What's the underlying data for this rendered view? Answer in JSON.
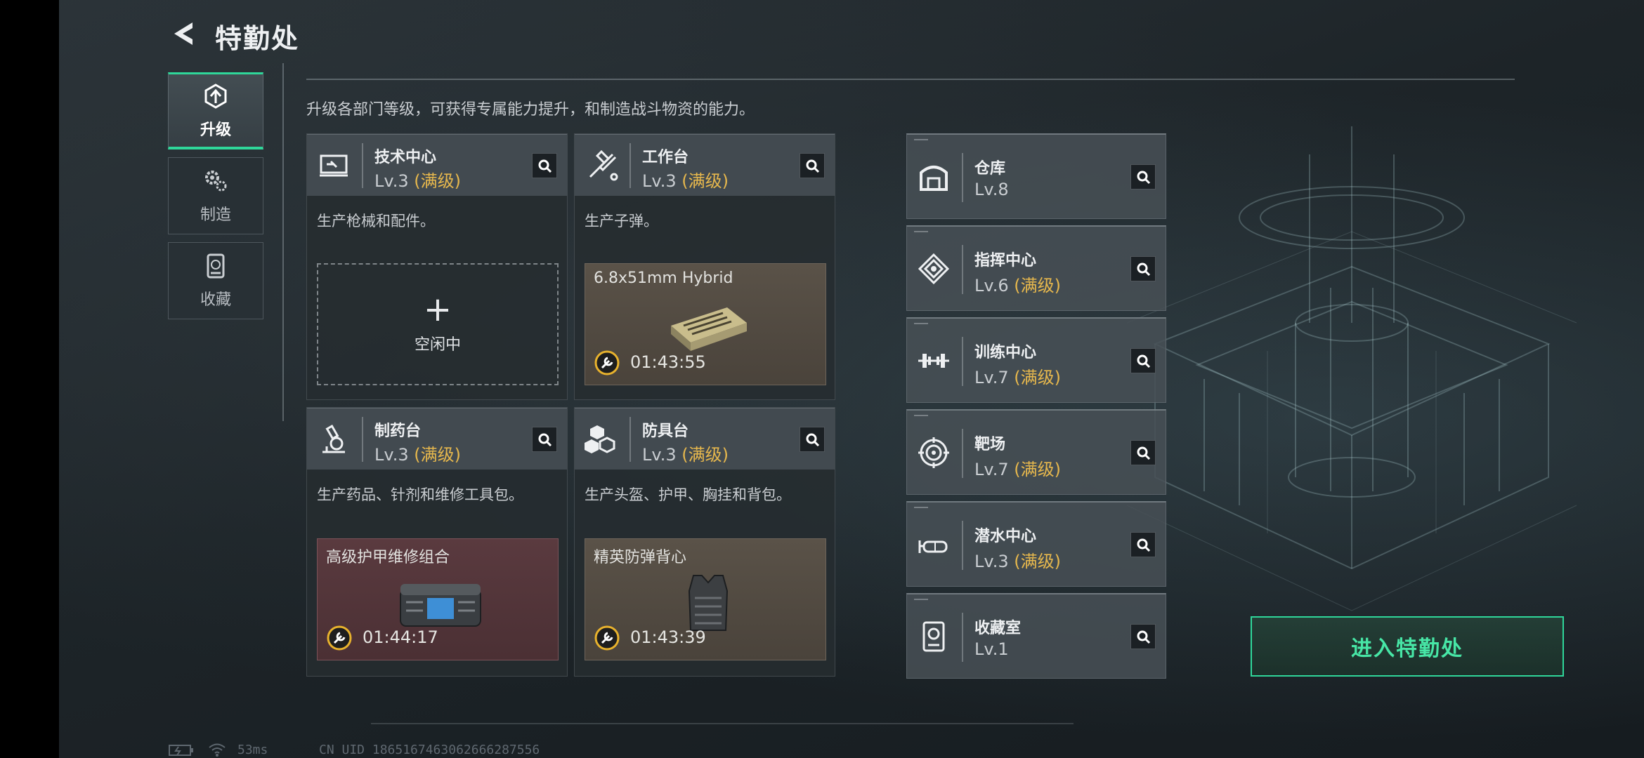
{
  "header": {
    "title": "特勤处"
  },
  "tabs": [
    {
      "label": "升级",
      "icon": "upgrade-icon",
      "active": true
    },
    {
      "label": "制造",
      "icon": "gears-icon",
      "active": false
    },
    {
      "label": "收藏",
      "icon": "collection-icon",
      "active": false
    }
  ],
  "description": "升级各部门等级，可获得专属能力提升，和制造战斗物资的能力。",
  "departments": [
    {
      "name": "技术中心",
      "level": "Lv.3",
      "max_label": "(满级)",
      "desc": "生产枪械和配件。",
      "icon": "tech-center-icon",
      "slot": {
        "state": "idle",
        "plus": "+",
        "label": "空闲中"
      }
    },
    {
      "name": "工作台",
      "level": "Lv.3",
      "max_label": "(满级)",
      "desc": "生产子弹。",
      "icon": "hammer-wrench-icon",
      "slot": {
        "state": "producing",
        "item": "6.8x51mm Hybrid",
        "timer": "01:43:55",
        "item_icon": "ammo-box-icon"
      }
    },
    {
      "name": "制药台",
      "level": "Lv.3",
      "max_label": "(满级)",
      "desc": "生产药品、针剂和维修工具包。",
      "icon": "microscope-icon",
      "slot": {
        "state": "producing",
        "item": "高级护甲维修组合",
        "timer": "01:44:17",
        "item_icon": "repair-kit-icon"
      }
    },
    {
      "name": "防具台",
      "level": "Lv.3",
      "max_label": "(满级)",
      "desc": "生产头盔、护甲、胸挂和背包。",
      "icon": "armor-blocks-icon",
      "slot": {
        "state": "producing",
        "item": "精英防弹背心",
        "timer": "01:43:39",
        "item_icon": "vest-icon"
      }
    }
  ],
  "facilities": [
    {
      "name": "仓库",
      "level": "Lv.8",
      "max_label": "",
      "icon": "warehouse-icon"
    },
    {
      "name": "指挥中心",
      "level": "Lv.6",
      "max_label": "(满级)",
      "icon": "command-icon"
    },
    {
      "name": "训练中心",
      "level": "Lv.7",
      "max_label": "(满级)",
      "icon": "dumbbell-icon"
    },
    {
      "name": "靶场",
      "level": "Lv.7",
      "max_label": "(满级)",
      "icon": "target-icon"
    },
    {
      "name": "潜水中心",
      "level": "Lv.3",
      "max_label": "(满级)",
      "icon": "diving-mask-icon"
    },
    {
      "name": "收藏室",
      "level": "Lv.1",
      "max_label": "",
      "icon": "collection-room-icon"
    }
  ],
  "enter_button": "进入特勤处",
  "status_bar": {
    "ping": "53ms",
    "uid": "CN UID 1865167463062666287556"
  },
  "colors": {
    "accent": "#2fd79a",
    "max_level": "#e7b84d",
    "timer_ring": "#e8b22d"
  }
}
